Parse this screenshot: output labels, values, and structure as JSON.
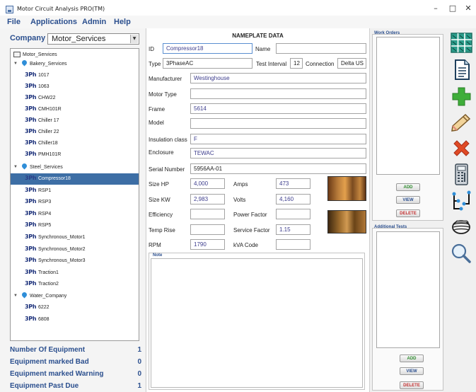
{
  "window": {
    "title": "Motor Circuit Analysis PRO(TM)",
    "minimize": "–",
    "maximize": "□",
    "close": "✕"
  },
  "menu": [
    "File",
    "Applications",
    "Admin",
    "Help"
  ],
  "company": {
    "label": "Company",
    "selected": "Motor_Services"
  },
  "tree": {
    "root": "Motor_Services",
    "groups": [
      {
        "name": "Bakery_Services",
        "items": [
          "1017",
          "1063",
          "CHW22",
          "CMH101R",
          "Chiller 17",
          "Chiller 22",
          "Chiller18",
          "PMH101R"
        ]
      },
      {
        "name": "Steel_Services",
        "items": [
          "Compressor18",
          "RSP1",
          "RSP3",
          "RSP4",
          "RSP5",
          "Synchronous_Motor1",
          "Synchronous_Motor2",
          "Synchronous_Motor3",
          "Traction1",
          "Traction2"
        ]
      },
      {
        "name": "Water_Company",
        "items": [
          "6222",
          "6808"
        ]
      }
    ],
    "selected_item": "Compressor18",
    "equipment_icon_text": "3Ph"
  },
  "stats": [
    {
      "label": "Number Of Equipment",
      "value": "1"
    },
    {
      "label": "Equipment marked Bad",
      "value": "0"
    },
    {
      "label": "Equipment marked Warning",
      "value": "0"
    },
    {
      "label": "Equipment Past Due",
      "value": "1"
    }
  ],
  "nameplate": {
    "title": "NAMEPLATE DATA",
    "id_label": "ID",
    "id_value": "Compressor18",
    "name_label": "Name",
    "name_value": "",
    "type_label": "Type",
    "type_value": "3PhaseAC",
    "test_interval_label": "Test Interval",
    "test_interval_value": "12",
    "connection_label": "Connection",
    "connection_value": "Delta US",
    "manufacturer_label": "Manufacturer",
    "manufacturer_value": "Westinghouse",
    "motor_type_label": "Motor Type",
    "motor_type_value": "",
    "frame_label": "Frame",
    "frame_value": "5614",
    "model_label": "Model",
    "model_value": "",
    "insulation_label": "Insulation class",
    "insulation_value": "F",
    "enclosure_label": "Enclosure",
    "enclosure_value": "TEWAC",
    "serial_label": "Serial Number",
    "serial_value": "5956AA-01",
    "size_hp_label": "Size HP",
    "size_hp_value": "4,000",
    "amps_label": "Amps",
    "amps_value": "473",
    "size_kw_label": "Size KW",
    "size_kw_value": "2,983",
    "volts_label": "Volts",
    "volts_value": "4,160",
    "efficiency_label": "Efficiency",
    "efficiency_value": "",
    "power_factor_label": "Power Factor",
    "power_factor_value": "",
    "temp_rise_label": "Temp Rise",
    "temp_rise_value": "",
    "service_factor_label": "Service Factor",
    "service_factor_value": "1.15",
    "rpm_label": "RPM",
    "rpm_value": "1790",
    "kva_label": "kVA Code",
    "kva_value": "",
    "note_label": "Note"
  },
  "work_orders": {
    "label": "Work Orders",
    "add": "ADD",
    "view": "VIEW",
    "delete": "DELETE"
  },
  "additional_tests": {
    "label": "Additional Tests",
    "add": "ADD",
    "view": "VIEW",
    "delete": "DELETE"
  },
  "toolbar_icons": [
    "grid-icon",
    "document-icon",
    "add-icon",
    "edit-pencil-icon",
    "delete-x-icon",
    "calculator-icon",
    "network-icon",
    "motor-icon",
    "search-icon"
  ],
  "colors": {
    "accent": "#2b4f8e",
    "selection": "#3d6ea5",
    "add": "#2e8a2e",
    "delete": "#c03030"
  }
}
